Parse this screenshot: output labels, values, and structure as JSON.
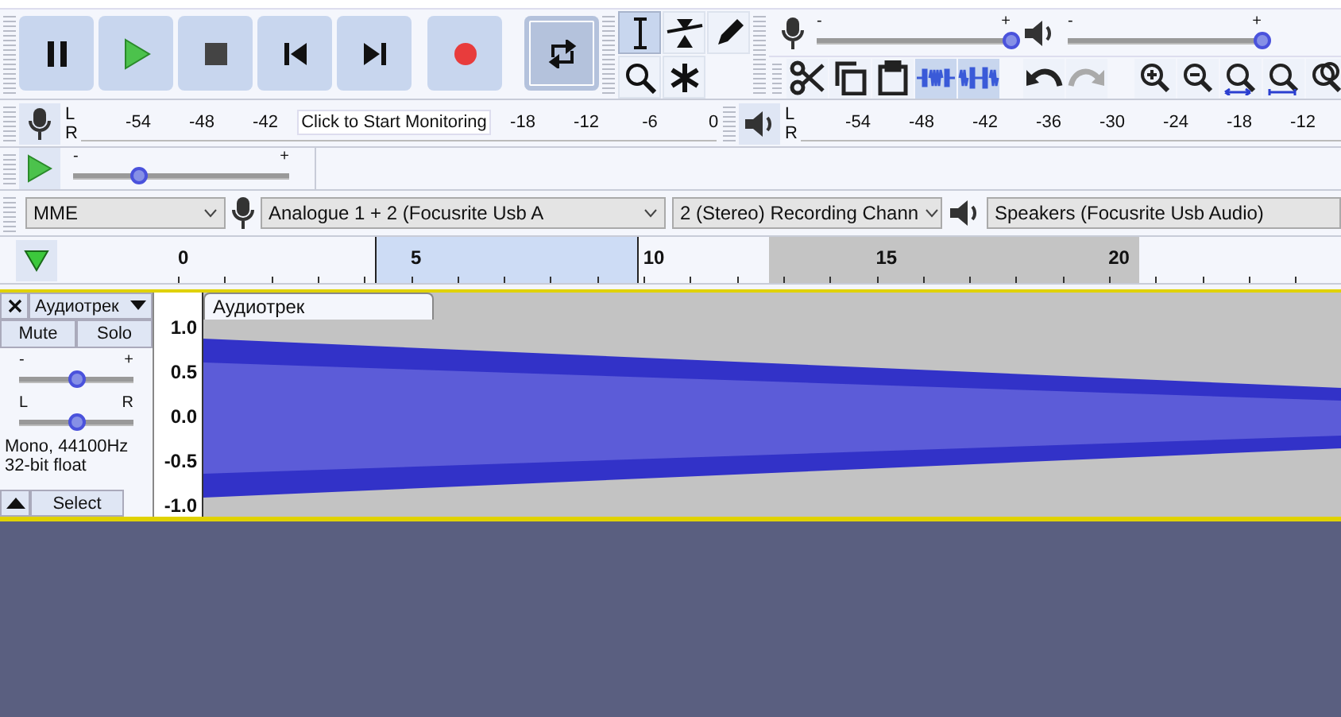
{
  "transport": [
    {
      "kind": "pause",
      "on": false
    },
    {
      "kind": "play",
      "on": false
    },
    {
      "kind": "stop",
      "on": false
    },
    {
      "kind": "skip_start",
      "on": false
    },
    {
      "kind": "skip_end",
      "on": false
    },
    {
      "kind": "record",
      "on": false
    },
    {
      "kind": "loop",
      "on": true
    }
  ],
  "tools": [
    {
      "kind": "select",
      "selected": true
    },
    {
      "kind": "envelope",
      "selected": false
    },
    {
      "kind": "draw",
      "selected": false
    },
    {
      "kind": "zoom",
      "selected": false
    },
    {
      "kind": "multi",
      "selected": false
    }
  ],
  "mixer": {
    "record": {
      "minus": "-",
      "plus": "+",
      "level": 1.0
    },
    "playback": {
      "minus": "-",
      "plus": "+",
      "level": 1.0
    }
  },
  "edit_tools": [
    {
      "kind": "cut",
      "disabled": false
    },
    {
      "kind": "copy",
      "disabled": false
    },
    {
      "kind": "paste",
      "disabled": false
    },
    {
      "kind": "trim",
      "disabled": false
    },
    {
      "kind": "silence",
      "disabled": false
    },
    {
      "kind": "undo",
      "disabled": false
    },
    {
      "kind": "redo",
      "disabled": true
    },
    {
      "kind": "zoom_in",
      "disabled": false
    },
    {
      "kind": "zoom_out",
      "disabled": false
    },
    {
      "kind": "fit_selection",
      "disabled": false
    },
    {
      "kind": "fit_project",
      "disabled": false
    },
    {
      "kind": "zoom_toggle",
      "disabled": false
    }
  ],
  "recording_meter": {
    "left": "L",
    "right": "R",
    "scale": [
      {
        "kind": "tick",
        "text": "-54"
      },
      {
        "kind": "tick",
        "text": "-48"
      },
      {
        "kind": "tick",
        "text": "-42"
      },
      {
        "kind": "message",
        "text": "Click to Start Monitoring"
      },
      {
        "kind": "tick",
        "text": "-18"
      },
      {
        "kind": "tick",
        "text": "-12"
      },
      {
        "kind": "tick",
        "text": "-6"
      },
      {
        "kind": "tick",
        "text": "0"
      }
    ]
  },
  "playback_meter": {
    "left": "L",
    "right": "R",
    "scale": [
      {
        "kind": "tick",
        "text": "-54"
      },
      {
        "kind": "tick",
        "text": "-48"
      },
      {
        "kind": "tick",
        "text": "-42"
      },
      {
        "kind": "tick",
        "text": "-36"
      },
      {
        "kind": "tick",
        "text": "-30"
      },
      {
        "kind": "tick",
        "text": "-24"
      },
      {
        "kind": "tick",
        "text": "-18"
      },
      {
        "kind": "tick",
        "text": "-12"
      }
    ]
  },
  "play_at_speed": {
    "minus": "-",
    "plus": "+",
    "level": 0.3
  },
  "devices": {
    "host": "MME",
    "recording_device": "Analogue 1 + 2 (Focusrite Usb A",
    "channels": "2 (Stereo) Recording Chann",
    "playback_device": "Speakers (Focusrite Usb Audio)"
  },
  "timeline": {
    "labels": [
      "0",
      "5",
      "10",
      "15",
      "20"
    ]
  },
  "track": {
    "name": "Аудиотрек",
    "mute": "Mute",
    "solo": "Solo",
    "gain": {
      "minus": "-",
      "plus": "+",
      "level": 0.5
    },
    "pan": {
      "left": "L",
      "right": "R",
      "level": 0.5
    },
    "info": [
      "Mono, 44100Hz",
      "32-bit float"
    ],
    "select": "Select",
    "scale": [
      "1.0",
      "0.5",
      "0.0",
      "-0.5",
      "-1.0"
    ],
    "clip_name": "Аудиотрек"
  }
}
